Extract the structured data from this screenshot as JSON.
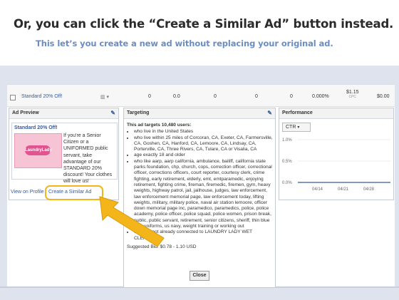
{
  "slide": {
    "title": "Or, you can click the “Create a Similar Ad” button instead.",
    "subtitle": "This let’s you create a new ad without replacing your original ad."
  },
  "ad_row": {
    "name": "Standard 20% Off!",
    "cells": [
      "0",
      "0.0",
      "0",
      "0",
      "0",
      "0.000%"
    ],
    "price": "$1.15",
    "price_unit": "CPC",
    "spent": "$0.00"
  },
  "ad_preview": {
    "header": "Ad Preview",
    "ad_title": "Standard 20% Off!",
    "logo_text": "LaundryLady",
    "body": "If you're a Senior Citizen or a UNIFORMED public servant, take advantage of our STANDARD 20% discount! Your clothes will love us!",
    "view_profile": "View on Profile",
    "create_similar": "Create a Similar Ad"
  },
  "targeting": {
    "header": "Targeting",
    "heading": "This ad targets 10,480 users:",
    "bullets": [
      "who live in the United States",
      "who live within 25 miles of Corcoran, CA, Exeter, CA, Farmersville, CA, Goshen, CA, Hanford, CA, Lemoore, CA, Lindsay, CA, Porterville, CA, Three Rivers, CA, Tulare, CA or Visalia, CA",
      "age exactly 18 and older",
      "who like aarp, aarp california, ambulance, bailiff, california state parks foundation, chp, church, cops, correction officer, correctional officer, corrections officers, court reporter, courtesy clerk, crime fighting, early retirement, elderly, emt, emtparamedic, enjoying retirement, fighting crime, fireman, firemedic, firemen, gym, heavy weights, highway patrol, jail, jailhouse, judges, law enforcement, law enforcement memorial page, law enforcement today, lifting weights, military, military police, naval air station lemoore, officer down memorial page inc, paramedico, paramedics, police, police academy, police officer, police squad, police women, prison break, public, public servant, retirement, senior citizens, sheriff, thin blue line, uniforms, us navy, weight training or working out",
      "who are not already connected to LAUNDRY LADY WET CLEANERS"
    ],
    "suggested_bid": "Suggested Bid: $0.78 - 1.10 USD",
    "close": "Close"
  },
  "performance": {
    "header": "Performance",
    "metric": "CTR",
    "y_ticks": [
      "1.0%",
      "0.5%",
      "0.0%"
    ],
    "x_ticks": [
      "04/14",
      "04/21",
      "04/28"
    ],
    "accent": "#3b5998"
  },
  "colors": {
    "link": "#3b5998",
    "highlight": "#f3b51a",
    "band": "#dfe3ee",
    "subtitle": "#6b8cc5"
  },
  "icons": {
    "edit": "pencil-icon",
    "pointer": "arrow-icon",
    "dropdown": "chevron-down-icon"
  }
}
